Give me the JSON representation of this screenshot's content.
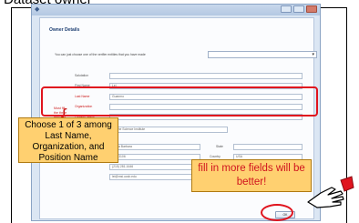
{
  "slide": {
    "title": "Dataset owner"
  },
  "window": {
    "icon": "app-icon",
    "section_header": "Owner Details",
    "choose_prompt": "You can just choose one of the verifier entities that you have made",
    "choose_select_value": "",
    "fields_top": [
      {
        "label": "Salutation",
        "value": ""
      },
      {
        "label": "First Name",
        "value": "Lei"
      }
    ],
    "fields_required": [
      {
        "label": "Last Name",
        "value": "Guanmo"
      },
      {
        "label": "Organization",
        "value": ""
      },
      {
        "label": "Position Name",
        "value": ""
      }
    ],
    "hint_text": "Must fill the three required",
    "org_full": "Marine Science Institute",
    "address": {
      "city": "Santa Barbara",
      "state_label": "State",
      "state": "",
      "zip_value": "Ca 93106",
      "country_label": "Country",
      "country": "USA",
      "phone": "(215) 281-1646",
      "fax_label": "Fax",
      "fax": "",
      "email": "lei@msi.ucsb.edu"
    },
    "ok_label": "OK"
  },
  "annotations": {
    "callout_choose": "Choose 1 of 3 among Last Name, Organization, and Position Name",
    "callout_fill": "fill in more fields will be better!",
    "pointer_icon": "pointing-hand-icon",
    "accent_red": "#e0141e",
    "callout_fill_color": "#ffd070"
  }
}
